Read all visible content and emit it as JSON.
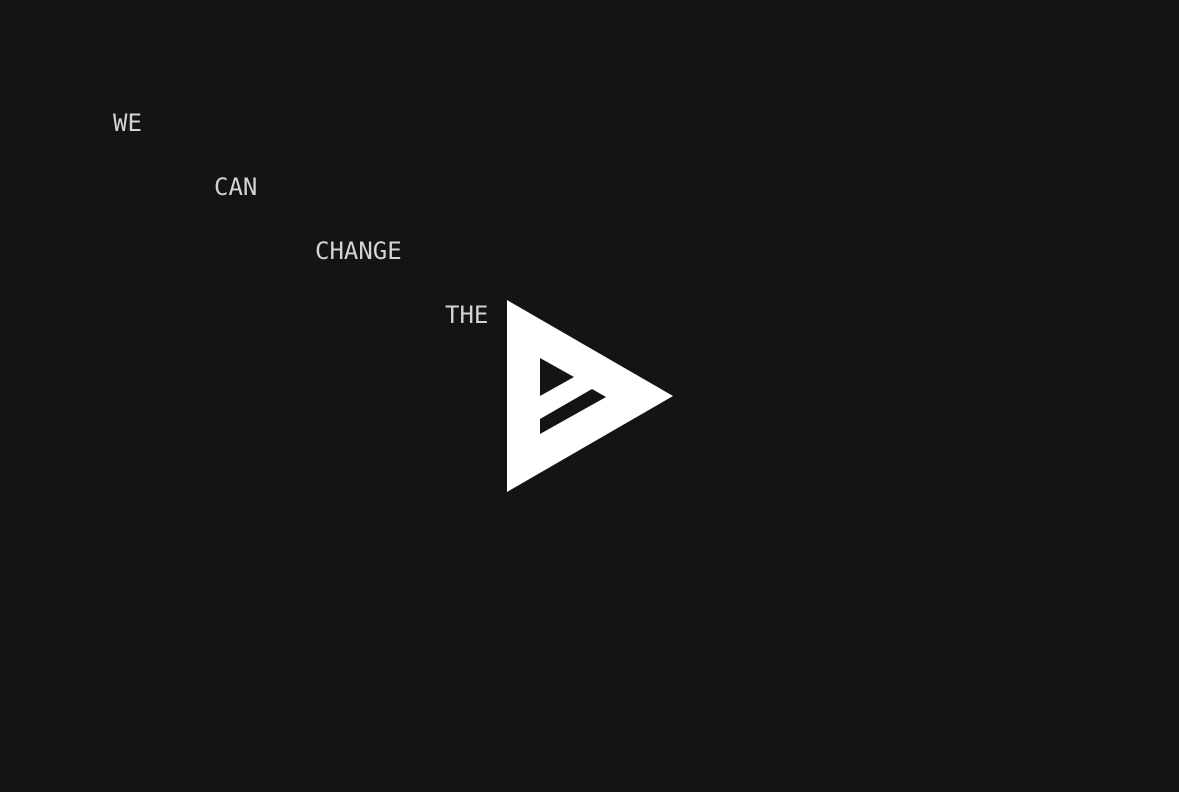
{
  "words": [
    "WE",
    "CAN",
    "CHANGE",
    "THE"
  ],
  "logo": {
    "icon": "triangle-play-logo-icon",
    "color": "#ffffff"
  },
  "colors": {
    "background": "#131416",
    "text": "#d3d3d5",
    "logo": "#ffffff"
  }
}
